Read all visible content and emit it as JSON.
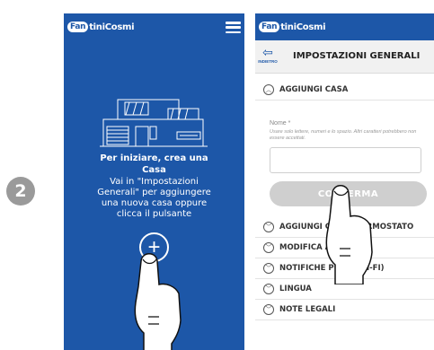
{
  "step": "2",
  "colors": {
    "brand_blue": "#1d57a8",
    "button_grey": "#cfcfcf"
  },
  "left_screen": {
    "brand_prefix": "Fan",
    "brand_suffix": "tiniCosmi",
    "menu_icon": "hamburger-icon",
    "illustration": "house-icon",
    "intro_title_line1": "Per iniziare, crea una",
    "intro_title_line2": "Casa",
    "intro_body_lines": [
      "Vai in \"Impostazioni",
      "Generali\" per aggiungere",
      "una nuova casa oppure",
      "clicca il pulsante"
    ],
    "add_button_icon": "plus-circle-icon"
  },
  "right_screen": {
    "brand_prefix": "Fan",
    "brand_suffix": "tiniCosmi",
    "back_label": "INDIETRO",
    "page_title": "IMPOSTAZIONI GENERALI",
    "section_open": "AGGIUNGI CASA",
    "name_label": "Nome *",
    "name_help": "Usare solo lettere, numeri e lo spazio. Altri caratteri potrebbero non essere accettati.",
    "name_value": "",
    "confirm_label": "CONFERMA",
    "sections": [
      "AGGIUNGI CRONOTERMOSTATO",
      "MODIFICA ACCOUNT",
      "NOTIFICHE PUSH (WI-FI)",
      "LINGUA",
      "NOTE LEGALI"
    ]
  }
}
